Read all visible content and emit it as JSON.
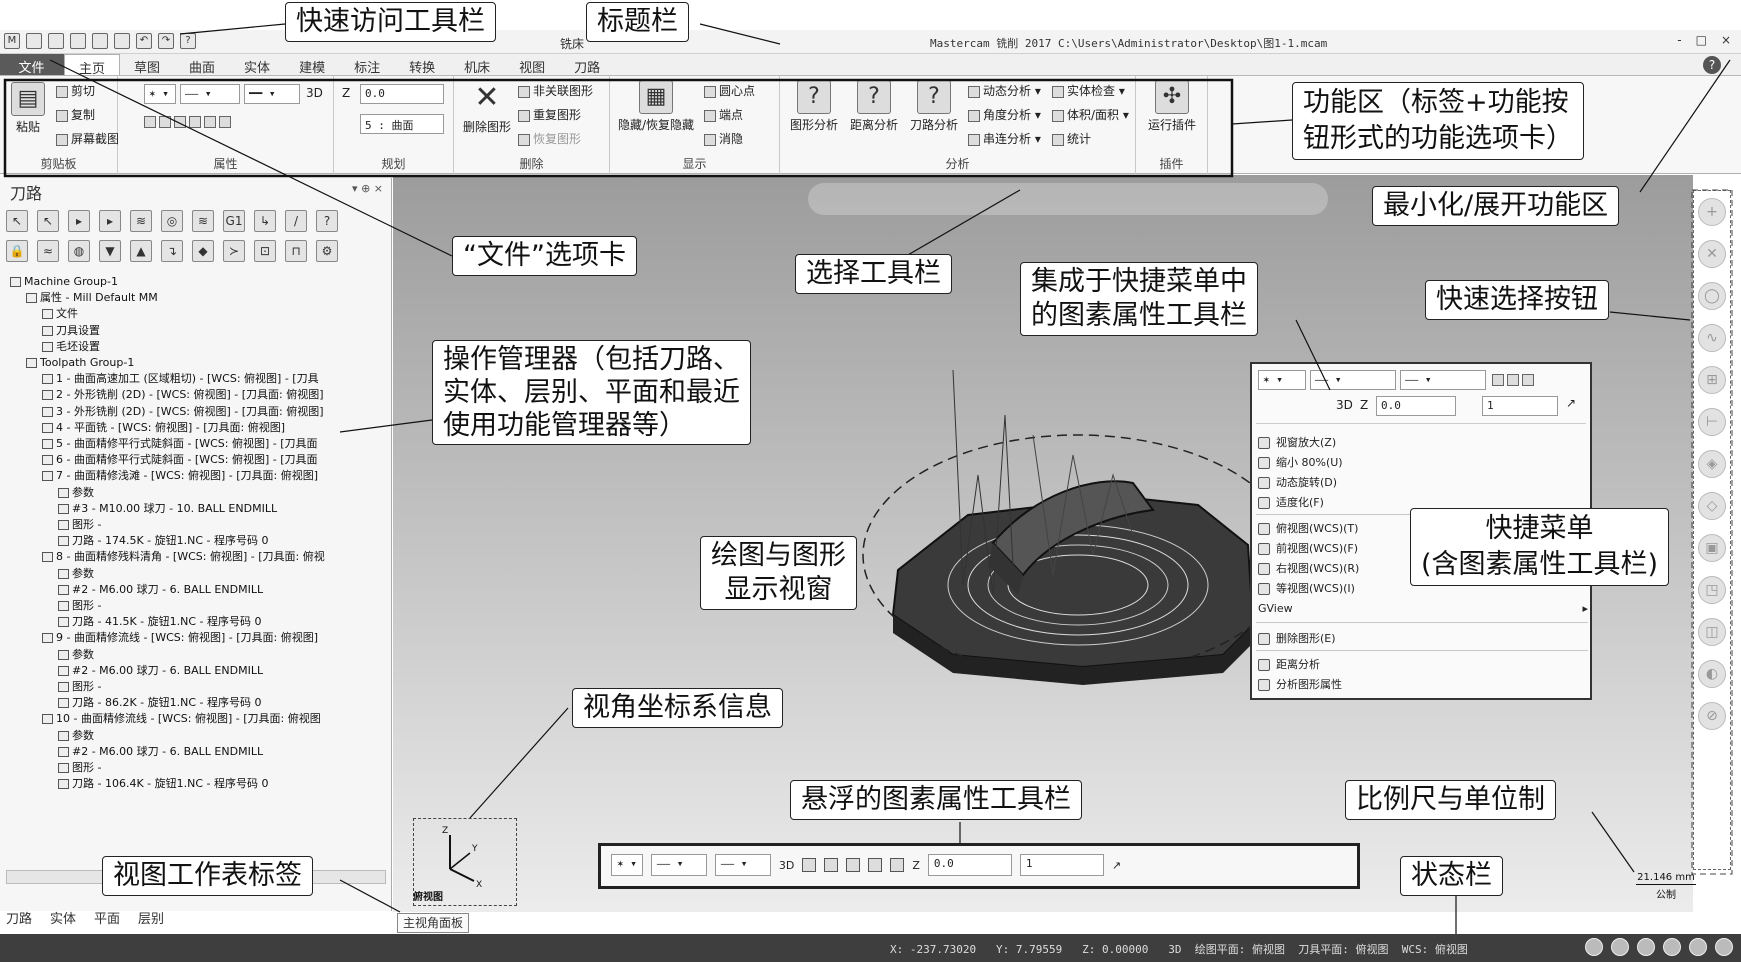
{
  "window": {
    "title": "Mastercam 铣削 2017  C:\\Users\\Administrator\\Desktop\\图1-1.mcam",
    "active_mode": "铣床",
    "controls": [
      "-",
      "□",
      "×"
    ]
  },
  "tabs": [
    "文件",
    "主页",
    "草图",
    "曲面",
    "实体",
    "建模",
    "标注",
    "转换",
    "机床",
    "视图",
    "刀路"
  ],
  "ribbon": {
    "clipboard": {
      "paste": "粘贴",
      "cut": "剪切",
      "copy": "复制",
      "screenshot": "屏幕截图",
      "label": "剪贴板"
    },
    "attributes": {
      "three_d": "3D",
      "label": "属性"
    },
    "planning": {
      "z_label": "Z",
      "z_value": "0.0",
      "level_value": "5 : 曲面",
      "label": "规划"
    },
    "delete": {
      "delete_entity": "删除图形",
      "unrelated": "非关联图形",
      "duplicate": "重复图形",
      "restore": "恢复图形",
      "label": "删除"
    },
    "display": {
      "hide_restore": "隐藏/恢复隐藏",
      "center_point": "圆心点",
      "endpoint": "端点",
      "blank": "消隐",
      "label": "显示"
    },
    "analysis": {
      "entity": "图形分析",
      "distance": "距离分析",
      "toolpath": "刀路分析",
      "dynamic": "动态分析",
      "angle": "角度分析",
      "chain": "串连分析",
      "solid_check": "实体检查",
      "volume_area": "体积/面积",
      "stats": "统计",
      "label": "分析"
    },
    "addins": {
      "run": "运行插件",
      "label": "插件"
    }
  },
  "panel": {
    "title": "刀路",
    "controls": "▾ ⊕ ×",
    "tree": [
      "Machine Group-1",
      "属性 - Mill Default MM",
      "文件",
      "刀具设置",
      "毛坯设置",
      "Toolpath Group-1",
      "1 - 曲面高速加工 (区域粗切) - [WCS: 俯视图] - [刀具",
      "2 - 外形铣削 (2D) - [WCS: 俯视图] - [刀具面: 俯视图]",
      "3 - 外形铣削 (2D) - [WCS: 俯视图] - [刀具面: 俯视图]",
      "4 - 平面铣 - [WCS: 俯视图] - [刀具面: 俯视图]",
      "5 - 曲面精修平行式陡斜面 - [WCS: 俯视图] - [刀具面",
      "6 - 曲面精修平行式陡斜面 - [WCS: 俯视图] - [刀具面",
      "7 - 曲面精修浅滩 - [WCS: 俯视图] - [刀具面: 俯视图]",
      "参数",
      "#3 - M10.00 球刀 -    10. BALL ENDMILL",
      "图形 -",
      "刀路 - 174.5K - 旋钮1.NC - 程序号码 0",
      "8 - 曲面精修残料清角 - [WCS: 俯视图] - [刀具面: 俯视",
      "参数",
      "#2 - M6.00 球刀 -    6. BALL ENDMILL",
      "图形 -",
      "刀路 - 41.5K - 旋钮1.NC - 程序号码 0",
      "9 - 曲面精修流线 - [WCS: 俯视图] - [刀具面: 俯视图]",
      "参数",
      "#2 - M6.00 球刀 -    6. BALL ENDMILL",
      "图形 -",
      "刀路 - 86.2K - 旋钮1.NC - 程序号码 0",
      "10 - 曲面精修流线 - [WCS: 俯视图] - [刀具面: 俯视图",
      "参数",
      "#2 - M6.00 球刀 -    6. BALL ENDMILL",
      "图形 -",
      "刀路 - 106.4K - 旋钮1.NC - 程序号码 0"
    ],
    "bottom_tabs": [
      "刀路",
      "实体",
      "平面",
      "层别"
    ]
  },
  "viewport": {
    "sheet_tab": "主视角面板",
    "triad_label": "俯视图",
    "scale_value": "21.146 mm",
    "scale_unit": "公制"
  },
  "context_menu": {
    "three_d": "3D",
    "z_label": "Z",
    "z_value": "0.0",
    "level_value": "1",
    "items": [
      "视窗放大(Z)",
      "缩小 80%(U)",
      "动态旋转(D)",
      "适度化(F)",
      "俯视图(WCS)(T)",
      "前视图(WCS)(F)",
      "右视图(WCS)(R)",
      "等视图(WCS)(I)",
      "GView",
      "删除图形(E)",
      "距离分析",
      "分析图形属性"
    ]
  },
  "float_attr": {
    "three_d": "3D",
    "z_label": "Z",
    "z_value": "0.0",
    "level_value": "1"
  },
  "statusbar": {
    "x_label": "X:",
    "x_value": "-237.73020",
    "y_label": "Y:",
    "y_value": "7.79559",
    "z_label": "Z:",
    "z_value": "0.00000",
    "mode": "3D",
    "cplane": "绘图平面: 俯视图",
    "tplane": "刀具平面: 俯视图",
    "wcs": "WCS: 俯视图"
  },
  "callouts": {
    "qat": "快速访问工具栏",
    "titlebar": "标题栏",
    "ribbon": "功能区（标签+功能按\n钮形式的功能选项卡）",
    "minimize": "最小化/展开功能区",
    "file_tab": "“文件”选项卡",
    "select_toolbar": "选择工具栏",
    "ctx_attr_toolbar": "集成于快捷菜单中\n的图素属性工具栏",
    "quick_select": "快速选择按钮",
    "manager": "操作管理器（包括刀路、\n实体、层别、平面和最近\n使用功能管理器等）",
    "graphics_window": "绘图与图形\n显示视窗",
    "context_menu": "快捷菜单\n(含图素属性工具栏)",
    "view_coord": "视角坐标系信息",
    "float_attr": "悬浮的图素属性工具栏",
    "scale": "比例尺与单位制",
    "view_sheet": "视图工作表标签",
    "status": "状态栏"
  }
}
